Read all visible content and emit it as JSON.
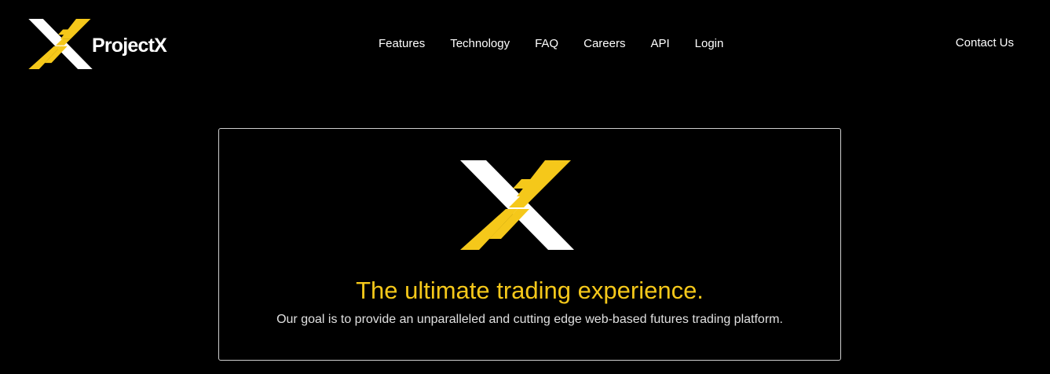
{
  "header": {
    "brand_name": "ProjectX",
    "nav": [
      "Features",
      "Technology",
      "FAQ",
      "Careers",
      "API",
      "Login"
    ],
    "contact_label": "Contact Us"
  },
  "hero": {
    "title": "The ultimate trading experience.",
    "subtitle": "Our goal is to provide an unparalleled and cutting edge web-based futures trading platform."
  },
  "colors": {
    "background": "#000000",
    "accent": "#f5c81a",
    "text": "#ffffff",
    "border": "#cfcfcf"
  },
  "icons": {
    "brand": "projectx-x-logo-icon",
    "hero": "projectx-x-logo-icon"
  }
}
